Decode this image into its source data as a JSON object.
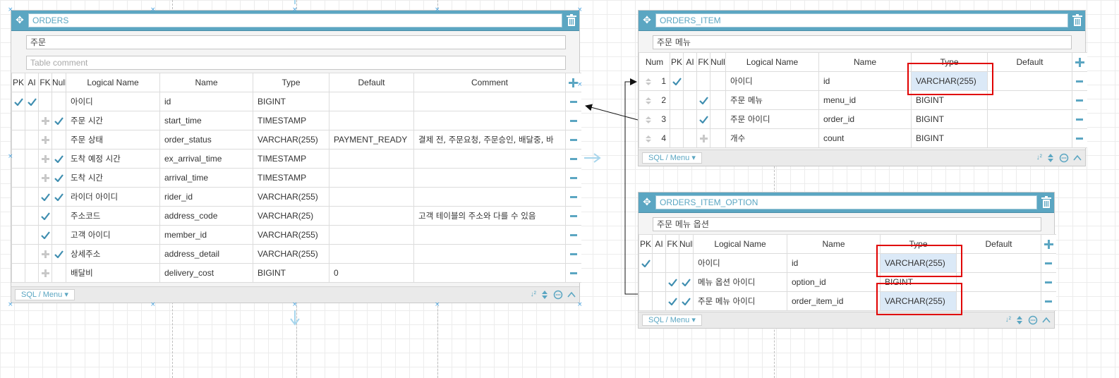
{
  "tables": {
    "orders": {
      "title": "ORDERS",
      "logical_name": "주문",
      "comment_placeholder": "Table comment",
      "headers": [
        "PK",
        "AI",
        "FK",
        "Null",
        "Logical Name",
        "Name",
        "Type",
        "Default",
        "Comment"
      ],
      "rows": [
        {
          "pk": true,
          "ai": true,
          "fk": false,
          "nn": false,
          "logical": "아이디",
          "name": "id",
          "type": "BIGINT",
          "default": "",
          "comment": ""
        },
        {
          "pk": false,
          "ai": false,
          "fk": false,
          "nn": true,
          "logical": "주문 시간",
          "name": "start_time",
          "type": "TIMESTAMP",
          "default": "",
          "comment": ""
        },
        {
          "pk": false,
          "ai": false,
          "fk": false,
          "nn": false,
          "logical": "주문 상태",
          "name": "order_status",
          "type": "VARCHAR(255)",
          "default": "PAYMENT_READY",
          "comment": "결제 전, 주문요청, 주문승인, 배달중, 바"
        },
        {
          "pk": false,
          "ai": false,
          "fk": false,
          "nn": true,
          "logical": "도착 예정 시간",
          "name": "ex_arrival_time",
          "type": "TIMESTAMP",
          "default": "",
          "comment": ""
        },
        {
          "pk": false,
          "ai": false,
          "fk": false,
          "nn": true,
          "logical": "도착 시간",
          "name": "arrival_time",
          "type": "TIMESTAMP",
          "default": "",
          "comment": ""
        },
        {
          "pk": false,
          "ai": false,
          "fk": true,
          "nn": true,
          "logical": "라이더 아이디",
          "name": "rider_id",
          "type": "VARCHAR(255)",
          "default": "",
          "comment": ""
        },
        {
          "pk": false,
          "ai": false,
          "fk": true,
          "nn": false,
          "logical": "주소코드",
          "name": "address_code",
          "type": "VARCHAR(25)",
          "default": "",
          "comment": "고객 테이블의 주소와 다를 수 있음"
        },
        {
          "pk": false,
          "ai": false,
          "fk": true,
          "nn": false,
          "logical": "고객 아이디",
          "name": "member_id",
          "type": "VARCHAR(255)",
          "default": "",
          "comment": ""
        },
        {
          "pk": false,
          "ai": false,
          "fk": false,
          "nn": true,
          "logical": "상세주소",
          "name": "address_detail",
          "type": "VARCHAR(255)",
          "default": "",
          "comment": ""
        },
        {
          "pk": false,
          "ai": false,
          "fk": false,
          "nn": false,
          "logical": "배달비",
          "name": "delivery_cost",
          "type": "BIGINT",
          "default": "0",
          "comment": ""
        }
      ],
      "footer": "SQL / Menu"
    },
    "orders_item": {
      "title": "ORDERS_ITEM",
      "logical_name": "주문 메뉴",
      "headers": [
        "Num",
        "PK",
        "AI",
        "FK",
        "Null",
        "Logical Name",
        "Name",
        "Type",
        "Default"
      ],
      "rows": [
        {
          "num": "1",
          "pk": true,
          "ai": false,
          "fk": false,
          "nn": false,
          "logical": "아이디",
          "name": "id",
          "type": "VARCHAR(255)",
          "default": "",
          "highlight": true
        },
        {
          "num": "2",
          "pk": false,
          "ai": false,
          "fk": true,
          "nn": false,
          "logical": "주문 메뉴",
          "name": "menu_id",
          "type": "BIGINT",
          "default": "",
          "highlight": false
        },
        {
          "num": "3",
          "pk": false,
          "ai": false,
          "fk": true,
          "nn": false,
          "logical": "주문 아이디",
          "name": "order_id",
          "type": "BIGINT",
          "default": "",
          "highlight": false
        },
        {
          "num": "4",
          "pk": false,
          "ai": false,
          "fk": false,
          "nn": false,
          "logical": "개수",
          "name": "count",
          "type": "BIGINT",
          "default": "",
          "highlight": false
        }
      ],
      "footer": "SQL / Menu"
    },
    "orders_item_option": {
      "title": "ORDERS_ITEM_OPTION",
      "logical_name": "주문 메뉴 옵션",
      "headers": [
        "PK",
        "AI",
        "FK",
        "Null",
        "Logical Name",
        "Name",
        "Type",
        "Default"
      ],
      "rows": [
        {
          "pk": true,
          "ai": false,
          "fk": false,
          "nn": false,
          "logical": "아이디",
          "name": "id",
          "type": "VARCHAR(255)",
          "default": "",
          "highlight": true
        },
        {
          "pk": false,
          "ai": false,
          "fk": true,
          "nn": true,
          "logical": "메뉴 옵션 아이디",
          "name": "option_id",
          "type": "BIGINT",
          "default": "",
          "highlight": false
        },
        {
          "pk": false,
          "ai": false,
          "fk": true,
          "nn": true,
          "logical": "주문 메뉴 아이디",
          "name": "order_item_id",
          "type": "VARCHAR(255)",
          "default": "",
          "highlight": true
        }
      ],
      "footer": "SQL / Menu"
    }
  },
  "colors": {
    "accent": "#5ba6c2",
    "check": "#3f8eb0",
    "highlight": "#e00000",
    "highlight_fill": "#dbe9f7"
  },
  "icons": [
    "move-icon",
    "trash-icon",
    "check-icon",
    "cross-icon",
    "minus-icon",
    "plus-icon",
    "sort-icon",
    "comment-icon",
    "collapse-icon",
    "reorder-icon"
  ]
}
